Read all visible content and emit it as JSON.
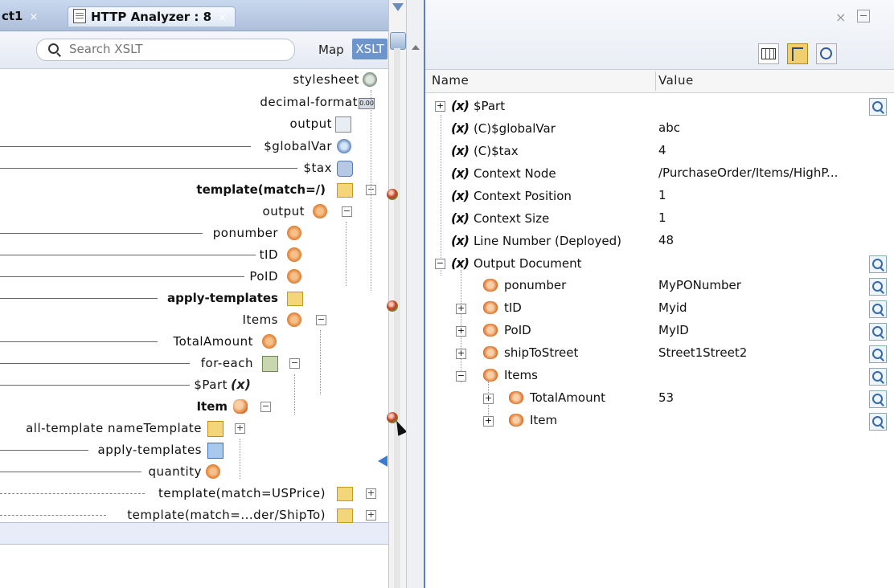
{
  "tabs": [
    {
      "label": "ct1",
      "close": "×"
    },
    {
      "label": "HTTP Analyzer : 8",
      "close": "×"
    }
  ],
  "toolbar": {
    "search_placeholder": "Search XSLT",
    "map_label": "Map",
    "xslt_label": "XSLT"
  },
  "xslt_tree": [
    {
      "label": "stylesheet",
      "icon": "stylesheet-icon",
      "bold": false
    },
    {
      "label": "decimal-format",
      "icon": "decimal-format-icon",
      "bold": false
    },
    {
      "label": "output",
      "icon": "output-icon",
      "bold": false
    },
    {
      "label": "$globalVar",
      "icon": "global-var-icon",
      "bold": false
    },
    {
      "label": "$tax",
      "icon": "tax-icon",
      "bold": false
    },
    {
      "label": "template(match=/)",
      "icon": "template-icon",
      "bold": true,
      "breakpoint": true
    },
    {
      "label": "output",
      "icon": "element-icon",
      "bold": false
    },
    {
      "label": "ponumber",
      "icon": "element-icon",
      "bold": false
    },
    {
      "label": "tID",
      "icon": "element-icon",
      "bold": false
    },
    {
      "label": "PoID",
      "icon": "element-icon",
      "bold": false
    },
    {
      "label": "apply-templates",
      "icon": "apply-templates-icon",
      "bold": true,
      "breakpoint": true
    },
    {
      "label": "Items",
      "icon": "element-icon",
      "bold": false
    },
    {
      "label": "TotalAmount",
      "icon": "element-icon",
      "bold": false
    },
    {
      "label": "for-each",
      "icon": "for-each-icon",
      "bold": false
    },
    {
      "label": "$Part",
      "icon": "variable-icon",
      "bold": false
    },
    {
      "label": "Item",
      "icon": "item-icon",
      "bold": true,
      "breakpoint": true
    },
    {
      "label": "all-template nameTemplate",
      "icon": "named-template-icon",
      "bold": false
    },
    {
      "label": "apply-templates",
      "icon": "apply-templates-icon",
      "bold": false,
      "current": true
    },
    {
      "label": "quantity",
      "icon": "element-icon",
      "bold": false
    },
    {
      "label": "template(match=USPrice)",
      "icon": "template-icon",
      "bold": false
    },
    {
      "label": "template(match=...der/ShipTo)",
      "icon": "template-icon",
      "bold": false
    }
  ],
  "variables_panel": {
    "col_name": "Name",
    "col_value": "Value",
    "rows": [
      {
        "name": "$Part",
        "value": "",
        "kind": "var"
      },
      {
        "name": "(C)$globalVar",
        "value": "abc",
        "kind": "var"
      },
      {
        "name": "(C)$tax",
        "value": "4",
        "kind": "var"
      },
      {
        "name": "Context Node",
        "value": "/PurchaseOrder/Items/HighP...",
        "kind": "var"
      },
      {
        "name": "Context Position",
        "value": "1",
        "kind": "var"
      },
      {
        "name": "Context Size",
        "value": "1",
        "kind": "var"
      },
      {
        "name": "Line Number (Deployed)",
        "value": "48",
        "kind": "var"
      },
      {
        "name": "Output Document",
        "value": "",
        "kind": "var"
      },
      {
        "name": "ponumber",
        "value": "MyPONumber",
        "kind": "el"
      },
      {
        "name": "tID",
        "value": "Myid",
        "kind": "el"
      },
      {
        "name": "PoID",
        "value": "MyID",
        "kind": "el"
      },
      {
        "name": "shipToStreet",
        "value": "Street1Street2",
        "kind": "el"
      },
      {
        "name": "Items",
        "value": "",
        "kind": "el"
      },
      {
        "name": "TotalAmount",
        "value": "53",
        "kind": "el"
      },
      {
        "name": "Item",
        "value": "",
        "kind": "el"
      }
    ]
  },
  "colors": {
    "accent": "#6d95cc",
    "breakpoint": "#c23b22",
    "element_icon": "#e07b2b"
  }
}
